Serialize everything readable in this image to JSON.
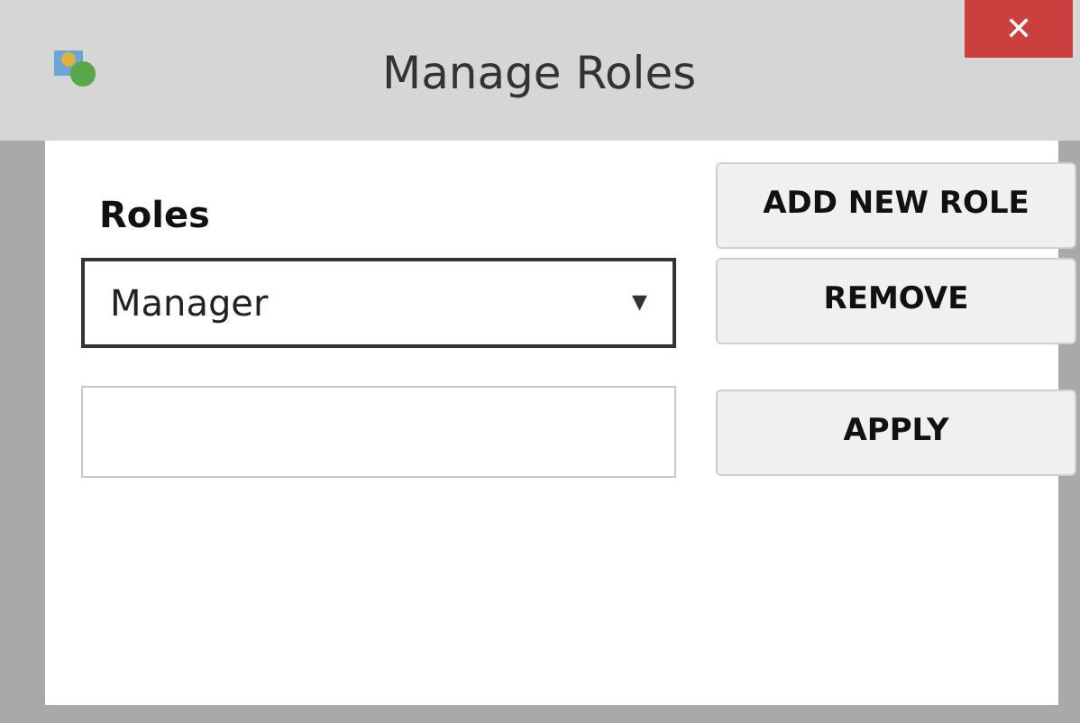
{
  "window": {
    "title": "Manage Roles",
    "close": "✕"
  },
  "roles_label": "Roles",
  "roles_dropdown": {
    "value": "Manager",
    "arrow": "▼"
  },
  "buttons": [
    {
      "label": "ADD NEW ROLE"
    },
    {
      "label": "REMOVE"
    },
    {
      "label": "APPLY"
    }
  ]
}
